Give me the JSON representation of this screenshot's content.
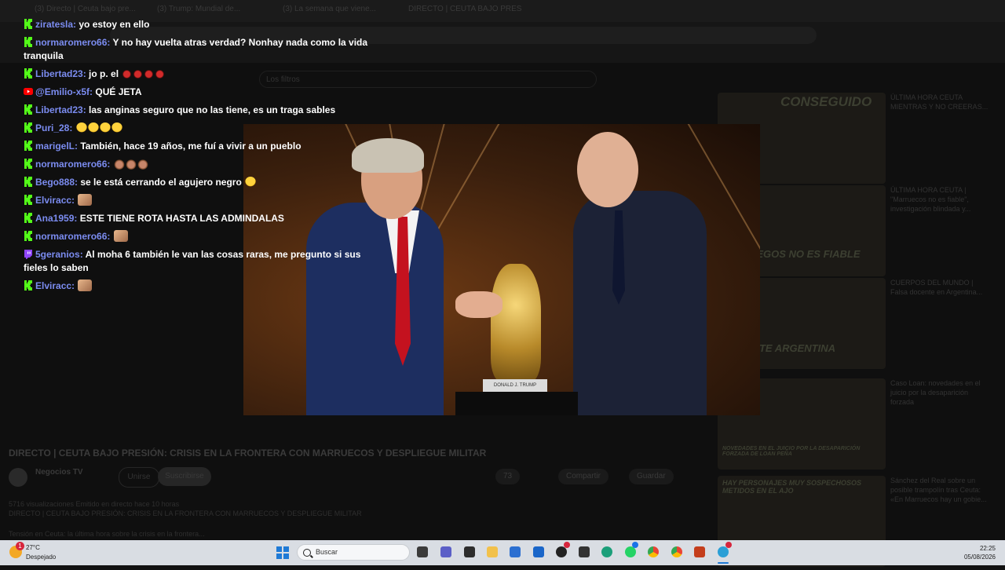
{
  "background": {
    "tabs": [
      "(3) Directo | Ceuta bajo pre...",
      "(3) Trump: Mundial de...",
      "(3) La semana que viene...",
      "DIRECTO | CEUTA BAJO PRES"
    ],
    "filter_label": "Los filtros",
    "video_title": "DIRECTO | CEUTA BAJO PRESIÓN: CRISIS EN LA FRONTERA CON MARRUECOS Y DESPLIEGUE MILITAR",
    "channel_name": "Negocios TV",
    "join_label": "Unirse",
    "subscribe_label": "Suscribirse",
    "likes": "73",
    "share_label": "Compartir",
    "save_label": "Guardar",
    "views_line": "5716 visualizaciones  Emitido en directo hace 10 horas",
    "desc_line1": "DIRECTO | CEUTA BAJO PRESIÓN: CRISIS EN LA FRONTERA CON MARRUECOS Y DESPLIEGUE MILITAR",
    "desc_line2": "Tensión en Ceuta: la última hora sobre la crisis en la frontera...",
    "related": [
      {
        "thumb_text": "CONSEGUIDO",
        "title": "ÚLTIMA HORA CEUTA MIENTRAS Y NO CREERAS..."
      },
      {
        "thumb_text": "LOS DIEGOS NO ES FIABLE",
        "title": "ÚLTIMA HORA CEUTA | \"Marruecos no es fiable\", investigación blindada y..."
      },
      {
        "thumb_text": "DOCENTE ARGENTINA",
        "title": "CUERPOS DEL MUNDO | Falsa docente en Argentina..."
      },
      {
        "thumb_text": "NOVEDADES EN EL JUICIO POR LA DESAPARICIÓN FORZADA DE LOAN PEÑA",
        "title": "Caso Loan: novedades en el juicio por la desaparición forzada"
      },
      {
        "thumb_text": "HAY PERSONAJES MUY SOSPECHOSOS METIDOS EN EL AJO",
        "title": "Sánchez del Real sobre un posible trampolín tras Ceuta: «En Marruecos hay un gobie..."
      }
    ]
  },
  "chat": [
    {
      "badge": "kick",
      "user": "ziratesla",
      "text": "yo estoy en ello",
      "emotes": []
    },
    {
      "badge": "kick",
      "user": "normaromero66",
      "text": "Y no hay vuelta atras verdad? Nonhay nada como la vida tranquila",
      "emotes": []
    },
    {
      "badge": "kick",
      "user": "Libertad23",
      "text": "jo p. el",
      "emotes": [
        "virus",
        "virus",
        "virus",
        "virus"
      ]
    },
    {
      "badge": "youtube",
      "user": "@Emilio-x5f",
      "text": "QUÉ JETA",
      "emotes": []
    },
    {
      "badge": "kick",
      "user": "Libertad23",
      "text": "las anginas seguro que no las tiene, es un traga sables",
      "emotes": []
    },
    {
      "badge": "kick",
      "user": "Puri_28",
      "text": "",
      "emotes": [
        "laugh",
        "laugh",
        "laugh",
        "laugh"
      ]
    },
    {
      "badge": "kick",
      "user": "marigelL",
      "text": "También, hace 19 años, me fuí a vivir a un pueblo",
      "emotes": []
    },
    {
      "badge": "kick",
      "user": "normaromero66",
      "text": "",
      "emotes": [
        "monkey",
        "monkey",
        "monkey"
      ]
    },
    {
      "badge": "kick",
      "user": "Bego888",
      "text": "se le está cerrando el agujero negro",
      "emotes": [
        "laugh"
      ]
    },
    {
      "badge": "kick",
      "user": "Elviracc",
      "text": "",
      "emotes": [
        "face"
      ]
    },
    {
      "badge": "kick",
      "user": "Ana1959",
      "text": "ESTE TIENE ROTA HASTA LAS ADMINDALAS",
      "emotes": []
    },
    {
      "badge": "kick",
      "user": "normaromero66",
      "text": "",
      "emotes": [
        "face"
      ]
    },
    {
      "badge": "twitch",
      "user": "5geranios",
      "text": "Al moha 6 también le van las cosas raras, me pregunto si sus fieles lo saben",
      "emotes": []
    },
    {
      "badge": "kick",
      "user": "Elviracc",
      "text": "",
      "emotes": [
        "face"
      ]
    }
  ],
  "photo": {
    "plate_text": "DONALD J. TRUMP"
  },
  "taskbar": {
    "temperature": "27°C",
    "condition": "Despejado",
    "weather_badge": "1",
    "search_placeholder": "Buscar",
    "time": "22:25",
    "date": "05/08/2026",
    "icons": [
      "task-view-icon",
      "teams-icon",
      "xbox-icon",
      "file-explorer-icon",
      "store-icon",
      "outlook-icon",
      "github-icon",
      "unity-icon",
      "edge-icon",
      "whatsapp-icon",
      "chrome-icon",
      "chrome-alt-icon",
      "powerpoint-icon",
      "obs-app-icon"
    ]
  },
  "colors": {
    "username": "#7b8cf0",
    "kick_green": "#53fc18",
    "youtube_red": "#ff0000",
    "twitch_purple": "#9146ff"
  }
}
